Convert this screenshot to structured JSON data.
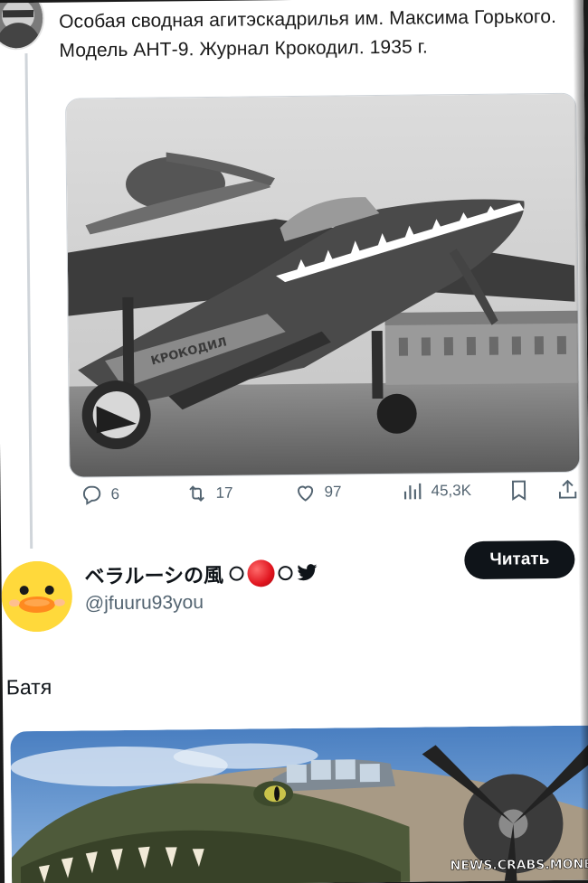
{
  "tweet1": {
    "text": "Особая сводная агитэскадрилья им. Максима Горького. Модель АНТ-9. Журнал Крокодил. 1935 г.",
    "photo_caption": "КРОКОДИЛ",
    "stats": {
      "replies": "6",
      "retweets": "17",
      "likes": "97",
      "views": "45,3K"
    }
  },
  "tweet2": {
    "display_name": "ベラルーシの風",
    "handle": "@jfuuru93you",
    "follow_label": "Читать",
    "text": "Батя"
  },
  "watermark": "NEWS.CRABS.MONEY",
  "colors": {
    "text_primary": "#0f1419",
    "text_secondary": "#536471",
    "button_bg": "#0f1419",
    "duck_yellow": "#ffd93b",
    "red_dot": "#e0141e"
  },
  "icons": {
    "reply": "reply-icon",
    "retweet": "retweet-icon",
    "like": "heart-icon",
    "views": "views-icon",
    "bookmark": "bookmark-icon",
    "share": "share-icon",
    "bird": "twitter-bird-icon"
  }
}
